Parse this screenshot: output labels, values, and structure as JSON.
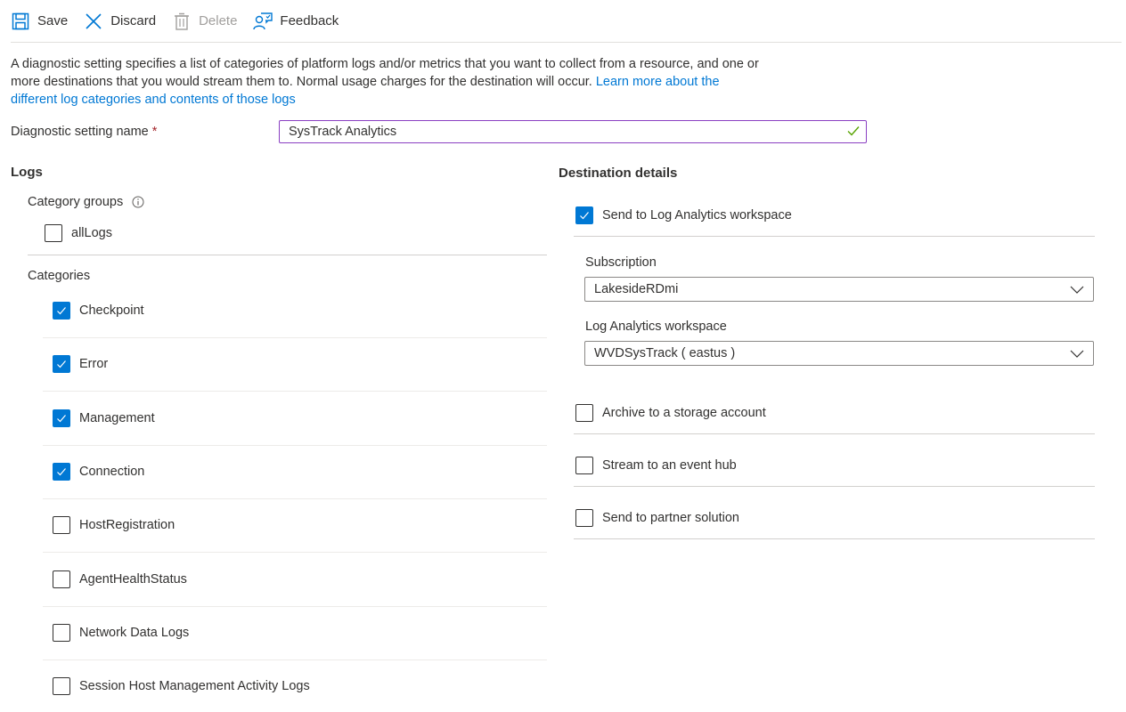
{
  "toolbar": {
    "save": "Save",
    "discard": "Discard",
    "delete": "Delete",
    "feedback": "Feedback"
  },
  "description": {
    "text": "A diagnostic setting specifies a list of categories of platform logs and/or metrics that you want to collect from a resource, and one or more destinations that you would stream them to. Normal usage charges for the destination will occur. ",
    "link": "Learn more about the different log categories and contents of those logs"
  },
  "name_field": {
    "label": "Diagnostic setting name",
    "required_mark": "*",
    "value": "SysTrack Analytics"
  },
  "logs": {
    "heading": "Logs",
    "category_groups_label": "Category groups",
    "category_groups": [
      {
        "label": "allLogs",
        "checked": false
      }
    ],
    "categories_label": "Categories",
    "categories": [
      {
        "label": "Checkpoint",
        "checked": true
      },
      {
        "label": "Error",
        "checked": true
      },
      {
        "label": "Management",
        "checked": true
      },
      {
        "label": "Connection",
        "checked": true
      },
      {
        "label": "HostRegistration",
        "checked": false
      },
      {
        "label": "AgentHealthStatus",
        "checked": false
      },
      {
        "label": "Network Data Logs",
        "checked": false
      },
      {
        "label": "Session Host Management Activity Logs",
        "checked": false
      }
    ]
  },
  "destination": {
    "heading": "Destination details",
    "log_analytics": {
      "label": "Send to Log Analytics workspace",
      "checked": true
    },
    "subscription_label": "Subscription",
    "subscription_value": "LakesideRDmi",
    "workspace_label": "Log Analytics workspace",
    "workspace_value": "WVDSysTrack ( eastus )",
    "others": [
      {
        "label": "Archive to a storage account",
        "checked": false
      },
      {
        "label": "Stream to an event hub",
        "checked": false
      },
      {
        "label": "Send to partner solution",
        "checked": false
      }
    ]
  },
  "colors": {
    "accent": "#0078d4",
    "valid": "#57a300",
    "focus_border": "#8a3fc2",
    "required": "#a4262c"
  }
}
